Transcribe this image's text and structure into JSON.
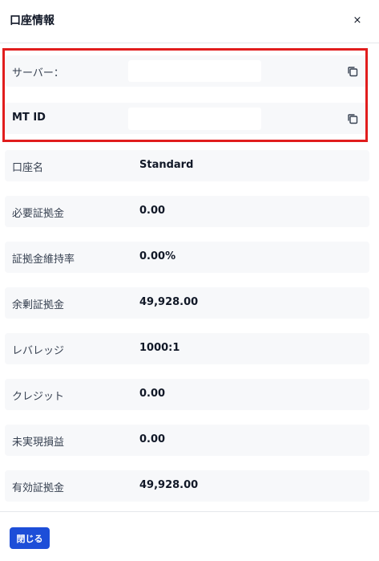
{
  "dialog": {
    "title": "口座情報",
    "close_glyph": "×"
  },
  "credentials": {
    "server_label": "サーバー：",
    "mt_id_label": "MT ID"
  },
  "account": {
    "rows": [
      {
        "label": "口座名",
        "value": "Standard"
      },
      {
        "label": "必要証拠金",
        "value": "0.00"
      },
      {
        "label": "証拠金維持率",
        "value": "0.00%"
      },
      {
        "label": "余剰証拠金",
        "value": "49,928.00"
      },
      {
        "label": "レバレッジ",
        "value": "1000:1"
      },
      {
        "label": "クレジット",
        "value": "0.00"
      },
      {
        "label": "未実現損益",
        "value": "0.00"
      },
      {
        "label": "有効証拠金",
        "value": "49,928.00"
      }
    ]
  },
  "footer": {
    "close_label": "閉じる"
  },
  "colors": {
    "highlight_border": "#e11d1d",
    "primary_button": "#1d4ed8",
    "row_background": "#f7f8fa"
  }
}
